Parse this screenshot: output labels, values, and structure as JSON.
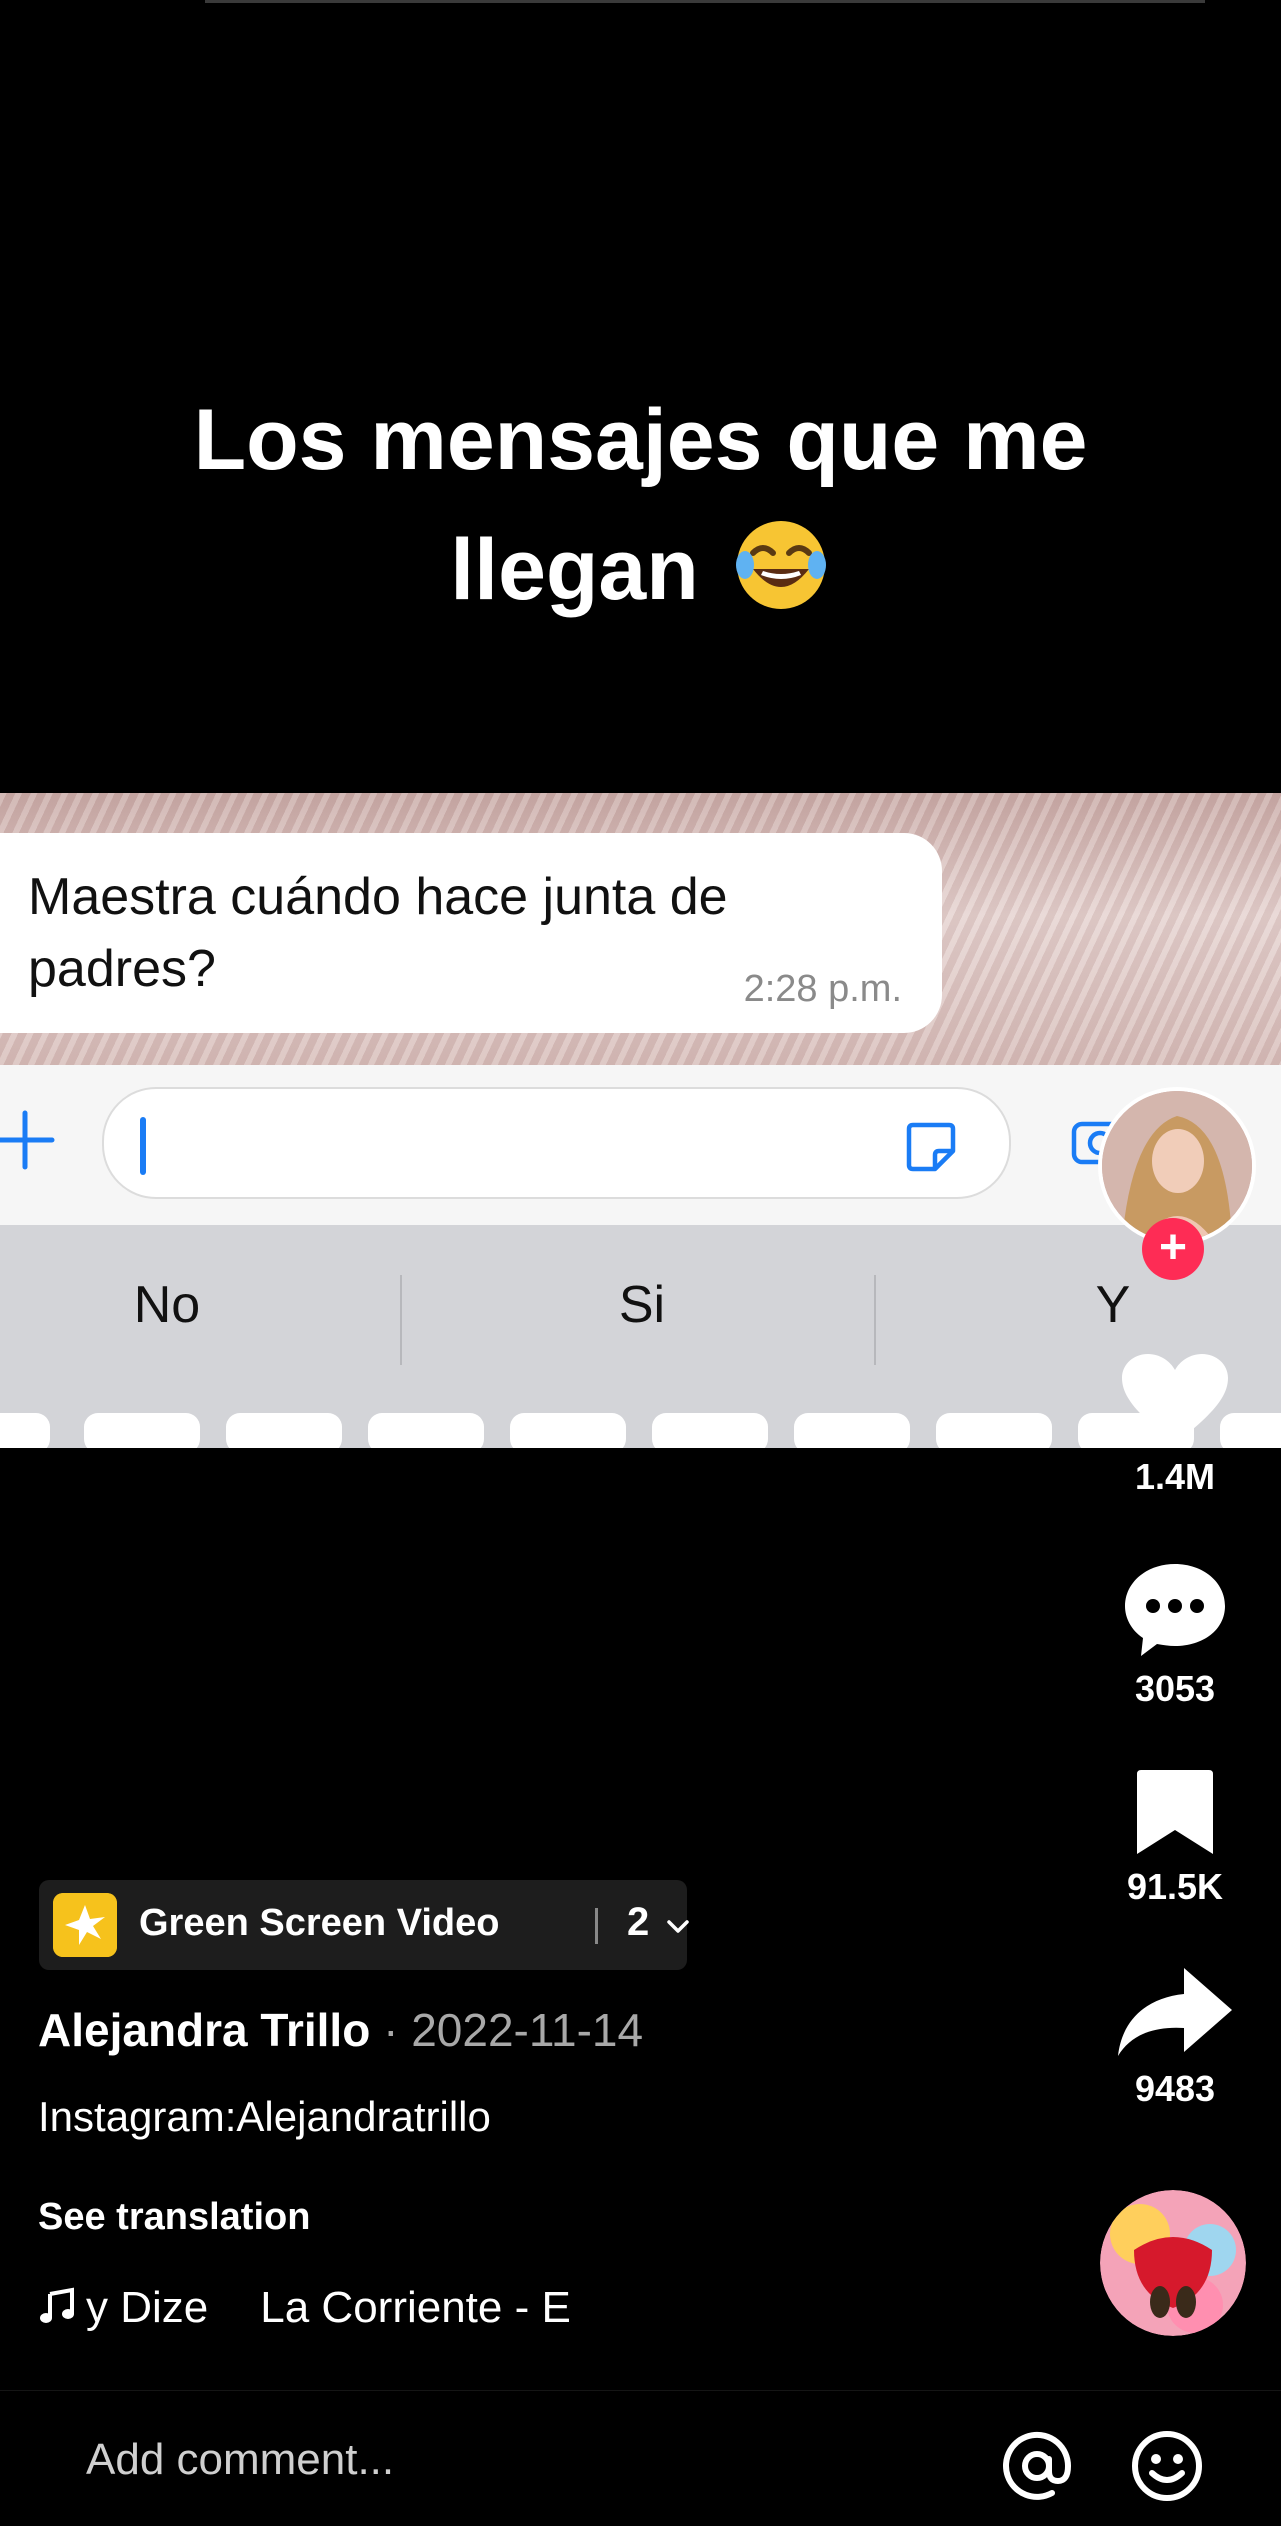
{
  "overlay": {
    "title_line1": "Los mensajes que me",
    "title_line2": "llegan",
    "emoji": "face-with-tears-of-joy-icon"
  },
  "chat": {
    "message": "Maestra cuándo hace junta de padres?",
    "time": "2:28 p.m.",
    "input_value": "",
    "suggestions": [
      "No",
      "Si",
      "Y"
    ]
  },
  "sidebar": {
    "likes": "1.4M",
    "comments": "3053",
    "saves": "91.5K",
    "shares": "9483",
    "follow_symbol": "+"
  },
  "effect": {
    "label": "Green Screen Video",
    "count": "2"
  },
  "post": {
    "author": "Alejandra Trillo",
    "separator": " · ",
    "date": "2022-11-14",
    "caption": "Instagram:Alejandratrillo",
    "see_translation": "See translation",
    "sound_part1": "y Dize",
    "sound_part2": "La Corriente - E"
  },
  "comment": {
    "placeholder": "Add comment..."
  },
  "colors": {
    "accent_red": "#fe2c55",
    "ios_blue": "#1a7cf5",
    "effect_yellow": "#f6c21c"
  }
}
